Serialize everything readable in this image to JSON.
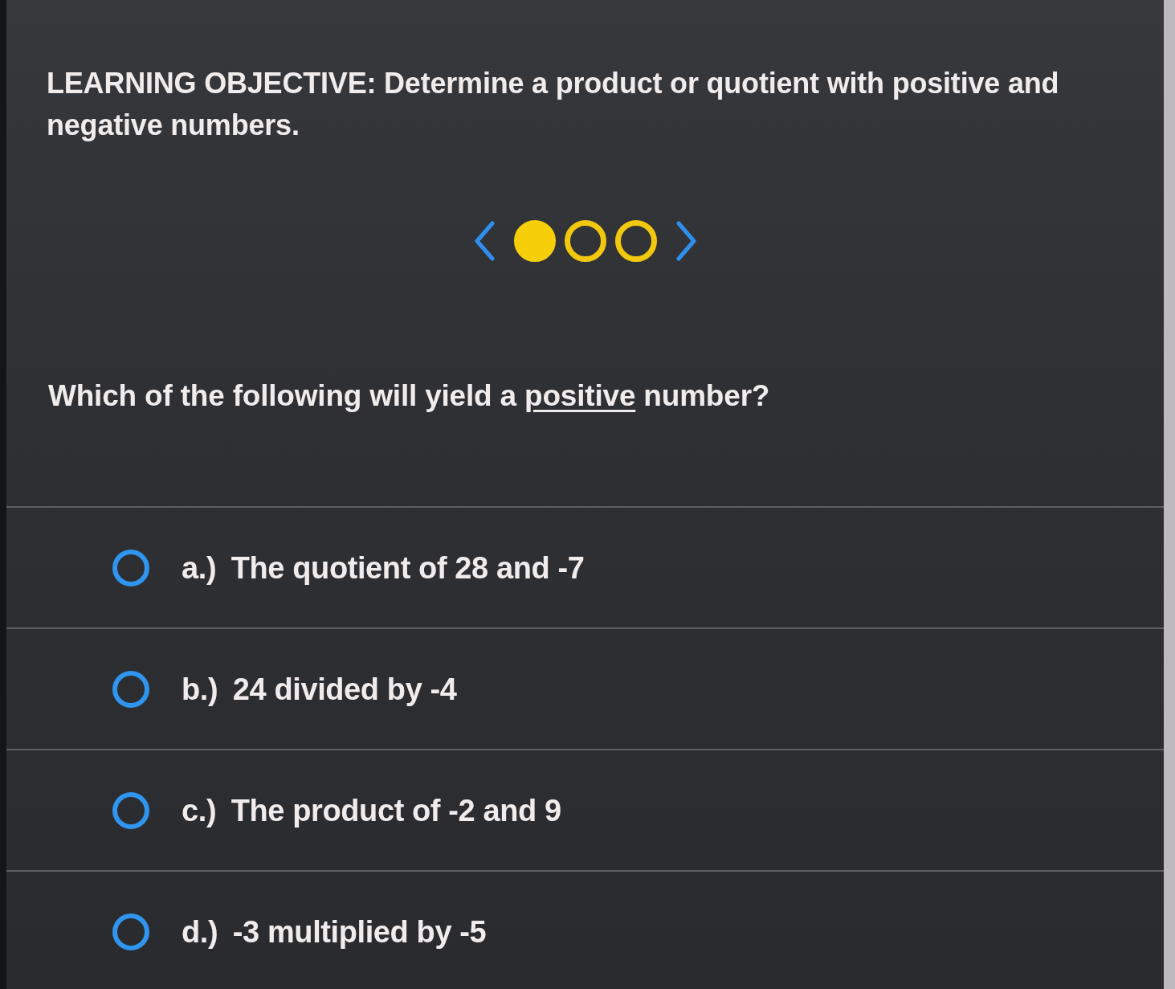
{
  "objective": {
    "text": "LEARNING OBJECTIVE: Determine a product or quotient with positive and negative numbers."
  },
  "pager": {
    "dots": [
      {
        "selected": true
      },
      {
        "selected": false
      },
      {
        "selected": false
      }
    ]
  },
  "question": {
    "parts": [
      {
        "text": "Which of the following will yield a",
        "underlined": false
      },
      {
        "text": "positive",
        "underlined": true
      },
      {
        "text": "number?",
        "underlined": false
      }
    ]
  },
  "options": [
    {
      "letter": "a.)",
      "text": "The quotient of 28 and -7",
      "selected": false
    },
    {
      "letter": "b.)",
      "text": "24 divided by -4",
      "selected": false
    },
    {
      "letter": "c.)",
      "text": "The product of -2 and 9",
      "selected": false
    },
    {
      "letter": "d.)",
      "text": "-3 multiplied by -5",
      "selected": false
    }
  ]
}
